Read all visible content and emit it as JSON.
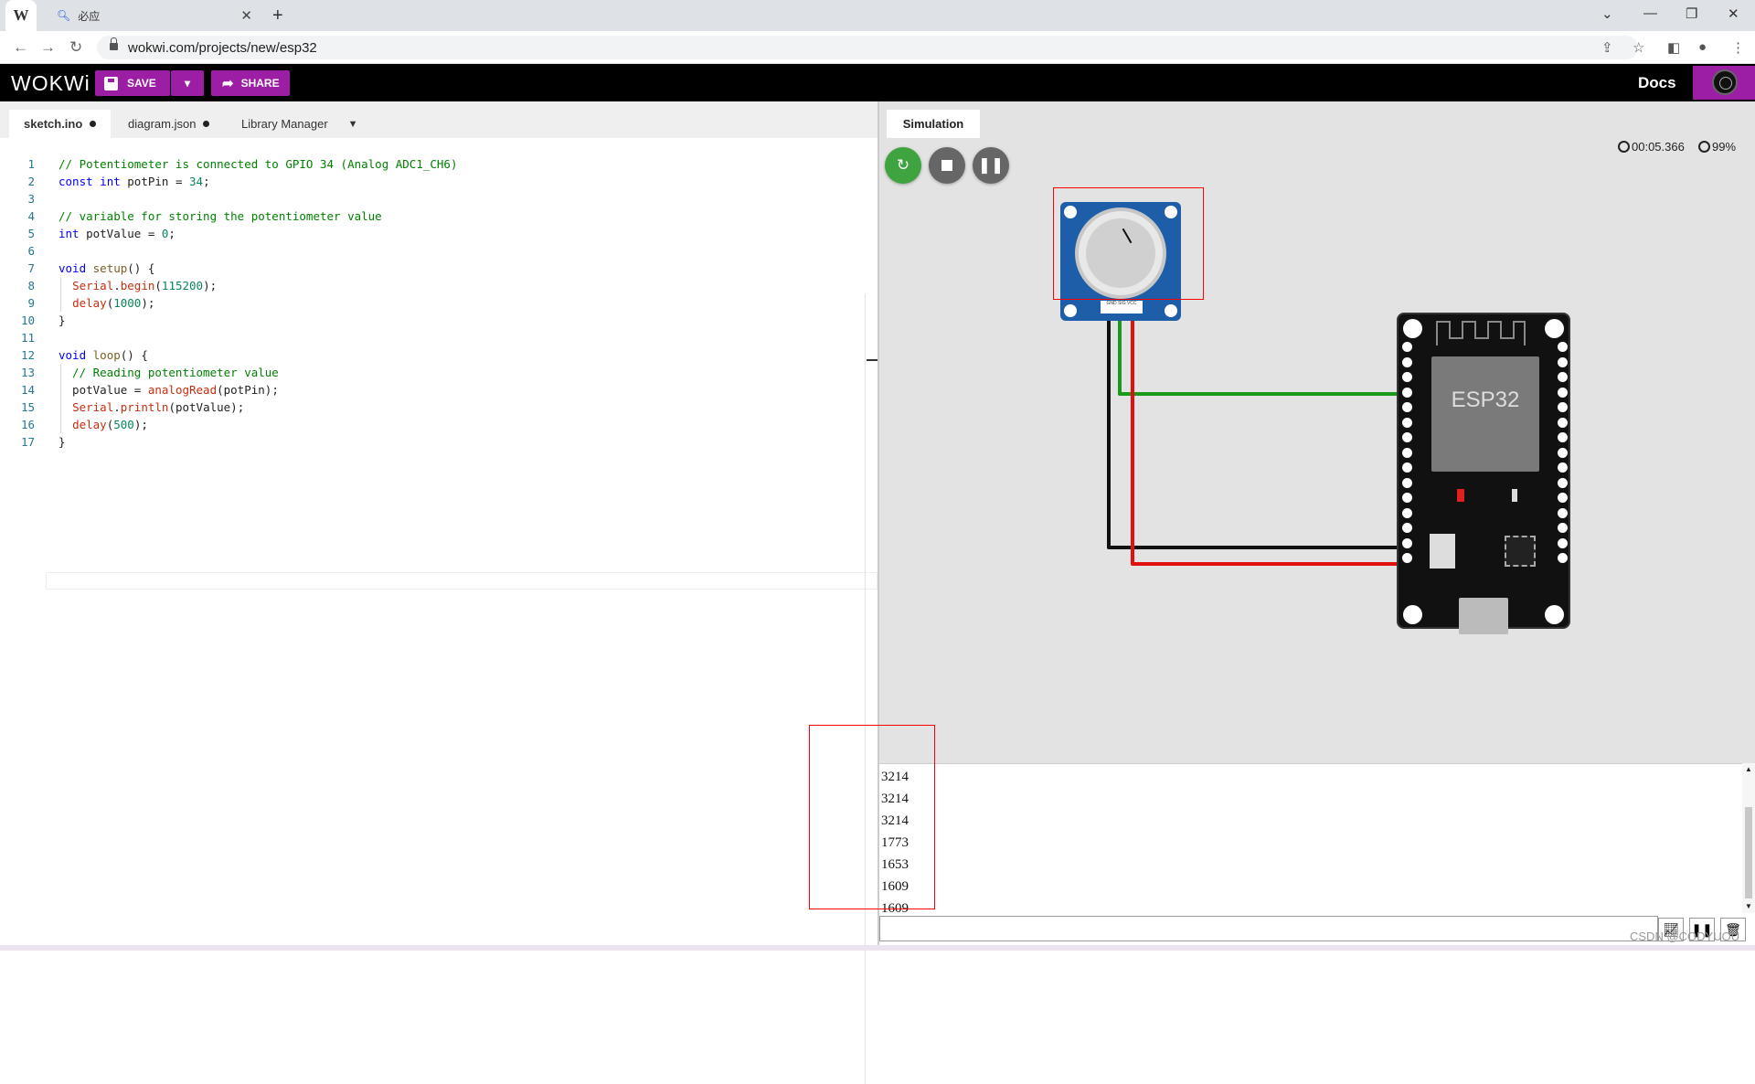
{
  "browser": {
    "tabs": [
      {
        "title": "W"
      },
      {
        "title": "必应"
      }
    ],
    "new_tab": "+",
    "url": "wokwi.com/projects/new/esp32",
    "window_controls": [
      "⌄",
      "—",
      "❐",
      "✕"
    ]
  },
  "toolbar": {
    "logo": "WOKWi",
    "save_label": "SAVE",
    "share_label": "SHARE",
    "docs_label": "Docs"
  },
  "editor": {
    "tabs": [
      {
        "label": "sketch.ino",
        "modified": true
      },
      {
        "label": "diagram.json",
        "modified": true
      },
      {
        "label": "Library Manager"
      }
    ],
    "lines": [
      {
        "n": "1",
        "text": "// Potentiometer is connected to GPIO 34 (Analog ADC1_CH6)"
      },
      {
        "n": "2",
        "text": "const int potPin = 34;"
      },
      {
        "n": "3",
        "text": ""
      },
      {
        "n": "4",
        "text": "// variable for storing the potentiometer value"
      },
      {
        "n": "5",
        "text": "int potValue = 0;"
      },
      {
        "n": "6",
        "text": ""
      },
      {
        "n": "7",
        "text": "void setup() {"
      },
      {
        "n": "8",
        "text": "  Serial.begin(115200);"
      },
      {
        "n": "9",
        "text": "  delay(1000);"
      },
      {
        "n": "10",
        "text": "}"
      },
      {
        "n": "11",
        "text": ""
      },
      {
        "n": "12",
        "text": "void loop() {"
      },
      {
        "n": "13",
        "text": "  // Reading potentiometer value"
      },
      {
        "n": "14",
        "text": "  potValue = analogRead(potPin);"
      },
      {
        "n": "15",
        "text": "  Serial.println(potValue);"
      },
      {
        "n": "16",
        "text": "  delay(500);"
      },
      {
        "n": "17",
        "text": "}"
      }
    ]
  },
  "simulation": {
    "tab_label": "Simulation",
    "timer": "00:05.366",
    "performance": "99%",
    "board_label": "ESP32",
    "pot_pin_labels": "GND SIG VCC",
    "colors": {
      "signal_wire": "#1a9a1a",
      "power_wire": "#e01010",
      "ground_wire": "#111111",
      "pot_board": "#1e5ea8"
    }
  },
  "serial_monitor": {
    "lines": [
      "3214",
      "3214",
      "3214",
      "1773",
      "1653",
      "1609",
      "1609"
    ]
  },
  "watermark": "CSDN @CODYUOU"
}
